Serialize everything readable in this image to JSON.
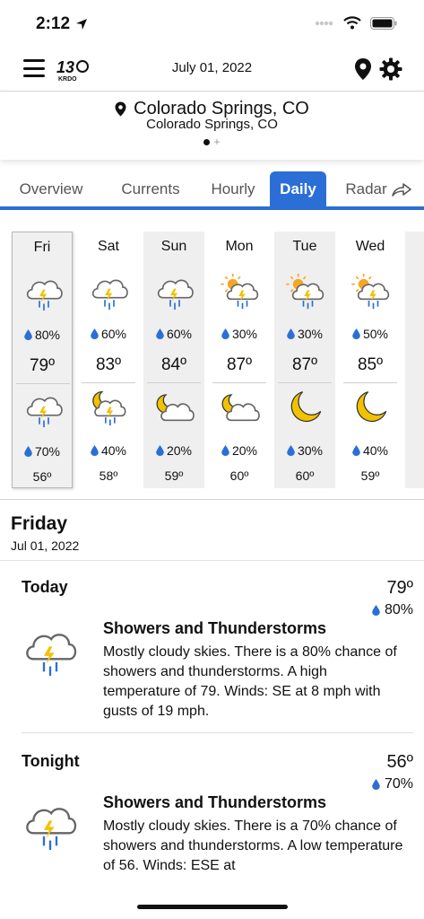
{
  "status_bar": {
    "time": "2:12"
  },
  "header": {
    "date": "July 01, 2022"
  },
  "location": {
    "primary": "Colorado Springs, CO",
    "secondary": "Colorado Springs, CO"
  },
  "tabs": [
    {
      "label": "Overview",
      "active": false
    },
    {
      "label": "Currents",
      "active": false
    },
    {
      "label": "Hourly",
      "active": false
    },
    {
      "label": "Daily",
      "active": true
    },
    {
      "label": "Radar",
      "active": false
    }
  ],
  "days": [
    {
      "name": "Fri",
      "day_icon": "thunderstorm-icon",
      "day_pct": "80%",
      "hi": "79º",
      "night_icon": "thunderstorm-icon",
      "night_pct": "70%",
      "lo": "56º"
    },
    {
      "name": "Sat",
      "day_icon": "thunderstorm-icon",
      "day_pct": "60%",
      "hi": "83º",
      "night_icon": "moon-cloud-storm-icon",
      "night_pct": "40%",
      "lo": "58º"
    },
    {
      "name": "Sun",
      "day_icon": "thunderstorm-icon",
      "day_pct": "60%",
      "hi": "84º",
      "night_icon": "moon-cloud-icon",
      "night_pct": "20%",
      "lo": "59º"
    },
    {
      "name": "Mon",
      "day_icon": "sun-cloud-storm-icon",
      "day_pct": "30%",
      "hi": "87º",
      "night_icon": "moon-cloud-icon",
      "night_pct": "20%",
      "lo": "60º"
    },
    {
      "name": "Tue",
      "day_icon": "sun-cloud-storm-icon",
      "day_pct": "30%",
      "hi": "87º",
      "night_icon": "moon-icon",
      "night_pct": "30%",
      "lo": "60º"
    },
    {
      "name": "Wed",
      "day_icon": "sun-cloud-storm-icon",
      "day_pct": "50%",
      "hi": "85º",
      "night_icon": "moon-icon",
      "night_pct": "40%",
      "lo": "59º"
    }
  ],
  "detail": {
    "title": "Friday",
    "date": "Jul 01, 2022",
    "periods": [
      {
        "name": "Today",
        "temp": "79º",
        "pct": "80%",
        "condition": "Showers and Thunderstorms",
        "description": "Mostly cloudy skies. There is a 80% chance of showers and thunderstorms. A high temperature of 79.  Winds: SE at 8 mph with gusts of 19 mph."
      },
      {
        "name": "Tonight",
        "temp": "56º",
        "pct": "70%",
        "condition": "Showers and Thunderstorms",
        "description": "Mostly cloudy skies. There is a 70% chance of showers and thunderstorms. A low temperature of 56.  Winds: ESE at"
      }
    ]
  },
  "colors": {
    "accent": "#2b6fd6",
    "rain_drop": "#2b6fd6",
    "bolt": "#f2c200",
    "sun": "#f5a623",
    "moon": "#f2c200"
  }
}
